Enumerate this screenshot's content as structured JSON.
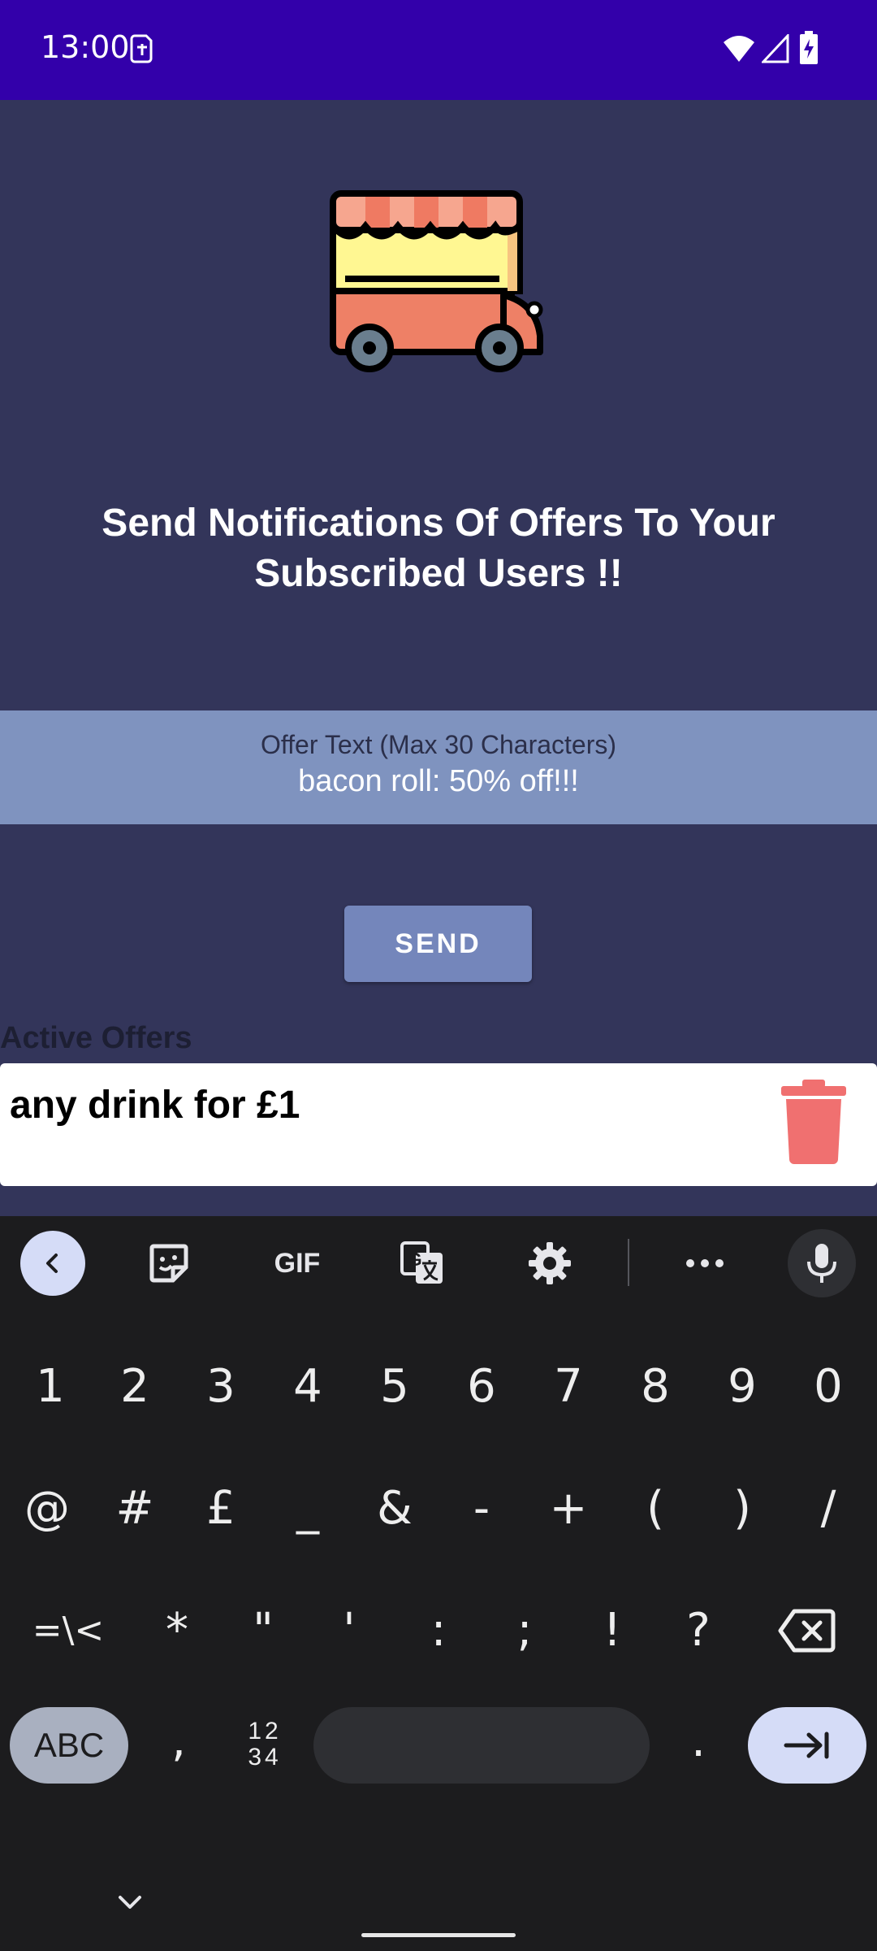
{
  "status_bar": {
    "time": "13:00"
  },
  "main": {
    "headline": "Send Notifications Of Offers To Your Subscribed Users !!",
    "offer_field": {
      "label": "Offer Text (Max 30 Characters)",
      "value": "bacon roll: 50% off!!!"
    },
    "send_label": "SEND",
    "active_offers_title": "Active Offers",
    "offers": [
      {
        "text": "any drink for £1"
      }
    ]
  },
  "keyboard": {
    "toolbar": {
      "gif_label": "GIF"
    },
    "number_row": [
      "1",
      "2",
      "3",
      "4",
      "5",
      "6",
      "7",
      "8",
      "9",
      "0"
    ],
    "symbol_row": [
      "@",
      "#",
      "£",
      "_",
      "&",
      "-",
      "+",
      "(",
      ")",
      "/"
    ],
    "symbol_row2": [
      "=\\<",
      "*",
      "\"",
      "'",
      ":",
      ";",
      "!",
      "?"
    ],
    "abc_label": "ABC",
    "comma": ",",
    "numpad_label_top": "12",
    "numpad_label_bottom": "34",
    "period": "."
  },
  "colors": {
    "status_bar": "#3300aa",
    "background": "#33355a",
    "field_bg": "#7f93bf",
    "send_button": "#7486bb",
    "trash": "#f07070",
    "keyboard_bg": "#1c1c1e"
  }
}
